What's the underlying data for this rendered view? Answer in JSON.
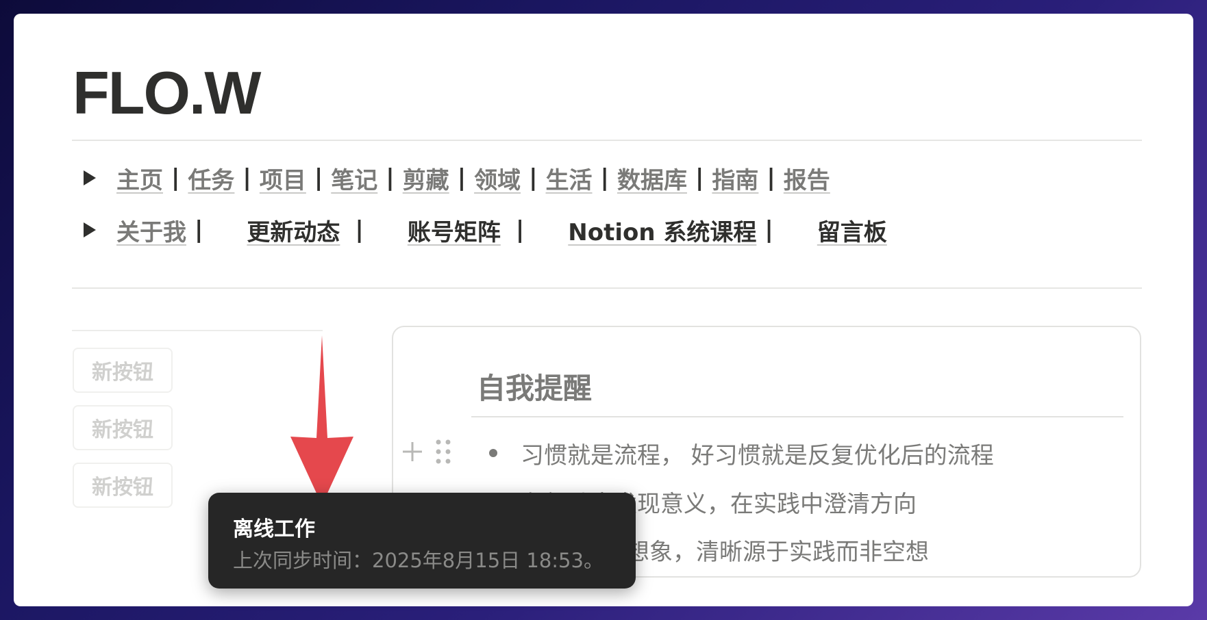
{
  "page": {
    "title": "FLO.W"
  },
  "nav": {
    "row1": [
      {
        "label": "主页"
      },
      {
        "label": "任务"
      },
      {
        "label": "项目"
      },
      {
        "label": "笔记"
      },
      {
        "label": "剪藏"
      },
      {
        "label": "领域"
      },
      {
        "label": "生活"
      },
      {
        "label": "数据库"
      },
      {
        "label": "指南"
      },
      {
        "label": "报告"
      }
    ],
    "separator": "|",
    "row2": [
      {
        "label": "关于我"
      },
      {
        "label": "更新动态"
      },
      {
        "label": "账号矩阵"
      },
      {
        "label": "Notion 系统课程"
      },
      {
        "label": "留言板"
      }
    ]
  },
  "sidebar": {
    "buttons": [
      {
        "label": "新按钮"
      },
      {
        "label": "新按钮"
      },
      {
        "label": "新按钮"
      }
    ]
  },
  "callout": {
    "title": "自我提醒",
    "items": [
      {
        "text": "习惯就是流程， 好习惯就是反复优化后的流程"
      },
      {
        "text": "在行动中发现意义，在实践中澄清方向"
      },
      {
        "text": "来的过度想象，清晰源于实践而非空想"
      }
    ]
  },
  "tooltip": {
    "title": "离线工作",
    "subtitle": "上次同步时间：2025年8月15日 18:53。"
  },
  "colors": {
    "arrow": "#e5484d",
    "tooltip_bg": "#262626",
    "text_muted": "#7a7a78",
    "text_dark": "#2f2f2d"
  },
  "icons": {
    "toggle": "triangle-right-icon",
    "add": "plus-icon",
    "drag": "drag-handle-icon",
    "annotation": "red-arrow-down"
  }
}
